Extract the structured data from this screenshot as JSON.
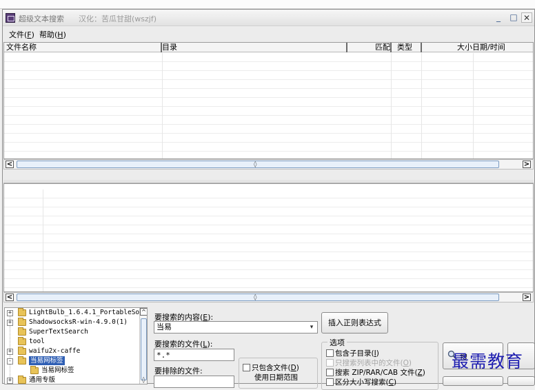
{
  "window": {
    "title": "超级文本搜索",
    "title_sub": "汉化：苦瓜甘甜(wszjf)",
    "min_glyph": "_",
    "max_glyph": "□",
    "close_glyph": "✕"
  },
  "menu": {
    "file": "文件(",
    "file_key": "F",
    "help": "帮助(",
    "help_key": "H",
    "close_paren": ")"
  },
  "results_table": {
    "columns": [
      "文件名称",
      "目录",
      "匹配",
      "类型",
      "大小",
      "日期/时间"
    ]
  },
  "scroll": {
    "left_arrow": "<",
    "right_arrow": ">",
    "up_arrow": "^",
    "grip": "◊"
  },
  "tree": {
    "items": [
      {
        "label": "LightBulb_1.6.4.1_PortableSof",
        "expander": "+"
      },
      {
        "label": "ShadowsocksR-win-4.9.0(1)",
        "expander": "+"
      },
      {
        "label": "SuperTextSearch",
        "expander": ""
      },
      {
        "label": "tool",
        "expander": ""
      },
      {
        "label": "waifu2x-caffe",
        "expander": "+"
      },
      {
        "label": "当易网标签",
        "expander": "-"
      },
      {
        "label": "当易网标签",
        "expander": ""
      },
      {
        "label": "通用专版",
        "expander": "+"
      }
    ]
  },
  "form": {
    "content_label": "要搜索的内容(",
    "content_key": "E",
    "content_value": "当易",
    "file_label": "要搜索的文件(",
    "file_key": "L",
    "file_value": "*.*",
    "exclude_label": "要排除的文件:",
    "exclude_value": "",
    "regex_button": "插入正则表达式",
    "dropdown_glyph": "▾",
    "colon_close": "):"
  },
  "date_group": {
    "only_files": "只包含文件(",
    "only_files_key": "D",
    "use_date_range": "使用日期范围"
  },
  "options": {
    "title": "选项",
    "include_subdirs": "包含子目录(",
    "include_subdirs_key": "I",
    "only_search_list": "只搜索列表中的文件(",
    "only_search_list_key": "O",
    "search_zip": "搜索 ZIP/RAR/CAB 文件(",
    "search_zip_key": "Z",
    "case_sensitive": "区分大小写搜索(",
    "case_sensitive_key": "C"
  },
  "search_button": {
    "label": "搜",
    "icon": "search-icon"
  },
  "watermark": "最需教育"
}
